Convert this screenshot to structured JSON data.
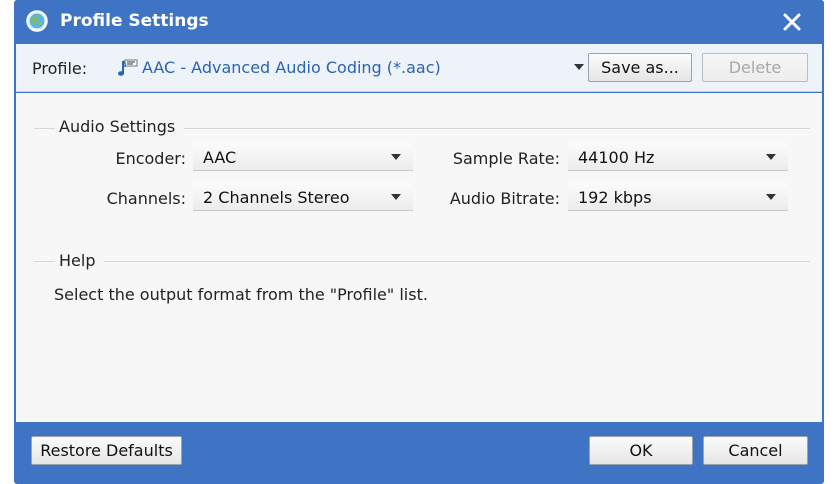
{
  "window": {
    "title": "Profile Settings"
  },
  "profile": {
    "label": "Profile:",
    "selected": "AAC - Advanced Audio Coding (*.aac)",
    "save_as_label": "Save as...",
    "delete_label": "Delete"
  },
  "audio_settings": {
    "title": "Audio Settings",
    "encoder_label": "Encoder:",
    "encoder_value": "AAC",
    "sample_rate_label": "Sample Rate:",
    "sample_rate_value": "44100 Hz",
    "channels_label": "Channels:",
    "channels_value": "2 Channels Stereo",
    "bitrate_label": "Audio Bitrate:",
    "bitrate_value": "192 kbps"
  },
  "help": {
    "title": "Help",
    "text": "Select the output format from the \"Profile\" list."
  },
  "footer": {
    "restore_label": "Restore Defaults",
    "ok_label": "OK",
    "cancel_label": "Cancel"
  },
  "colors": {
    "titlebar": "#3f74c5",
    "profile_link": "#2a64b4"
  }
}
